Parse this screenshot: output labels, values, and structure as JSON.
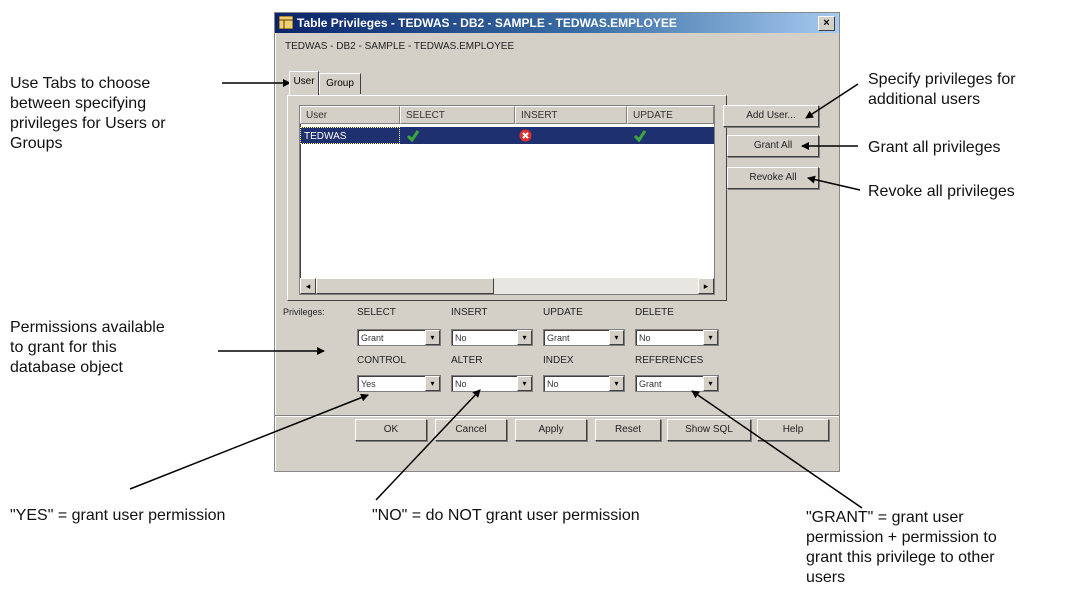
{
  "annotations": {
    "tabs_line1": "Use  Tabs to choose",
    "tabs_line2": "between specifying",
    "tabs_line3": "privileges for Users or",
    "tabs_line4": "Groups",
    "add_line1": "Specify privileges for",
    "add_line2": "additional users",
    "grant_all": "Grant all privileges",
    "revoke_all": "Revoke all privileges",
    "perm_line1": "Permissions available",
    "perm_line2": "to grant for this",
    "perm_line3": "database object",
    "yes_note": "\"YES\" = grant user  permission",
    "no_note": "\"NO\"  = do  NOT grant user permission",
    "grant_line1": "\"GRANT\" = grant user",
    "grant_line2": "permission + permission to",
    "grant_line3": "grant this privilege to other",
    "grant_line4": "users"
  },
  "dialog": {
    "title": "Table Privileges - TEDWAS - DB2 - SAMPLE - TEDWAS.EMPLOYEE",
    "close_glyph": "×",
    "subtitle": "TEDWAS - DB2 - SAMPLE - TEDWAS.EMPLOYEE",
    "tabs": [
      "User",
      "Group"
    ],
    "grid": {
      "headers": [
        "User",
        "SELECT",
        "INSERT",
        "UPDATE"
      ],
      "row": {
        "user": "TEDWAS",
        "select": "granted",
        "insert": "denied",
        "update": "granted"
      }
    },
    "scroll_left": "◂",
    "scroll_right": "▸",
    "side_buttons": [
      "Add User...",
      "Grant All",
      "Revoke All"
    ],
    "privileges_label": "Privileges:",
    "privileges": [
      {
        "label": "SELECT",
        "value": "Grant"
      },
      {
        "label": "INSERT",
        "value": "No"
      },
      {
        "label": "UPDATE",
        "value": "Grant"
      },
      {
        "label": "DELETE",
        "value": "No"
      },
      {
        "label": "CONTROL",
        "value": "Yes"
      },
      {
        "label": "ALTER",
        "value": "No"
      },
      {
        "label": "INDEX",
        "value": "No"
      },
      {
        "label": "REFERENCES",
        "value": "Grant"
      }
    ],
    "dropdown_glyph": "▾",
    "bottom_buttons": [
      "OK",
      "Cancel",
      "Apply",
      "Reset",
      "Show SQL",
      "Help"
    ]
  },
  "colors": {
    "selection_row": "#1f3070",
    "granted_icon": "#3aa83a",
    "denied_icon": "#e03030"
  }
}
